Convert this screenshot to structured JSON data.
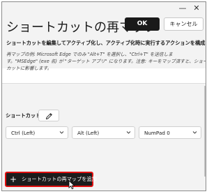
{
  "header": {
    "title": "ショートカットの再マップ",
    "ok_label": "OK",
    "cancel_label": "キャンセル"
  },
  "description": "ショートカットを編集してアクティブ化し、アクティブ化時に実行するアクションを構成します。",
  "example": {
    "line1": "再マップの例: Microsoft Edge でのみ \"Alt+T\" を選択し、\"Ctrl+T\" を送信しま",
    "line2": "す。\"MSEdge\" (exe 名) が \"ターゲット アプリ\" になります。注意: キーをマップ済すと、ショート",
    "line3": "カットに影響します。"
  },
  "shortcut": {
    "label": "ショートカット:",
    "keys": [
      "Ctrl (Left)",
      "Alt (Left)",
      "NumPad 0"
    ]
  },
  "add_button_label": "ショートカットの再マップを追加",
  "icons": {
    "edit": "pencil-icon",
    "add": "plus-icon",
    "dropdown": "chevron-down-icon"
  },
  "colors": {
    "primary_button": "#1a1a1a",
    "highlight_border": "#e01010"
  }
}
